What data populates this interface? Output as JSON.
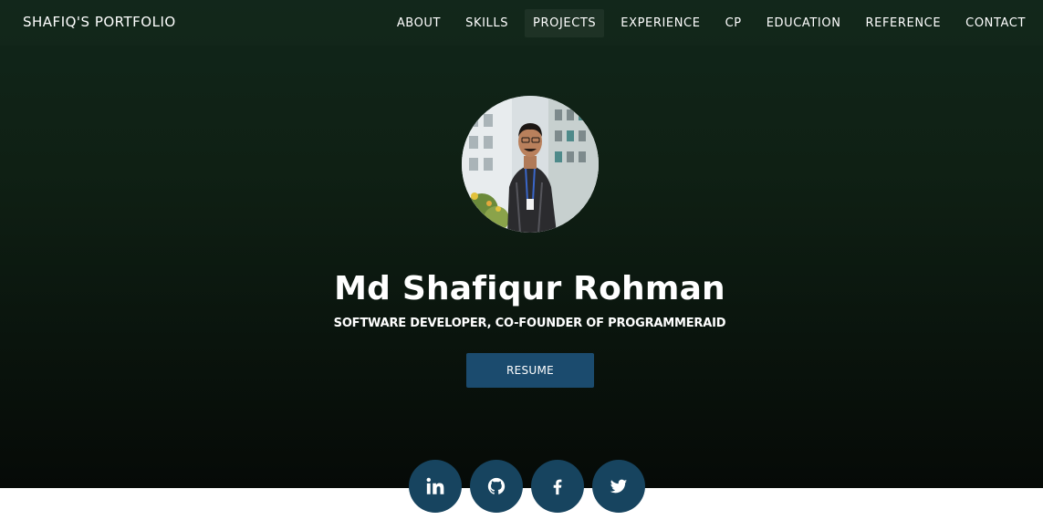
{
  "navbar": {
    "brand": "SHAFIQ'S PORTFOLIO",
    "links": [
      {
        "label": "ABOUT"
      },
      {
        "label": "SKILLS"
      },
      {
        "label": "PROJECTS",
        "active": true
      },
      {
        "label": "EXPERIENCE"
      },
      {
        "label": "CP"
      },
      {
        "label": "EDUCATION"
      },
      {
        "label": "REFERENCE"
      },
      {
        "label": "CONTACT"
      }
    ]
  },
  "hero": {
    "name": "Md Shafiqur Rohman",
    "tagline": "SOFTWARE DEVELOPER, CO-FOUNDER OF PROGRAMMERAID",
    "resume_label": "RESUME"
  },
  "socials": [
    {
      "icon": "linkedin-icon"
    },
    {
      "icon": "github-icon"
    },
    {
      "icon": "facebook-icon"
    },
    {
      "icon": "twitter-icon"
    }
  ],
  "colors": {
    "hero_top": "#11261a",
    "hero_bottom": "#060a07",
    "accent": "#1b4b6e",
    "social_bg": "#17445f"
  }
}
